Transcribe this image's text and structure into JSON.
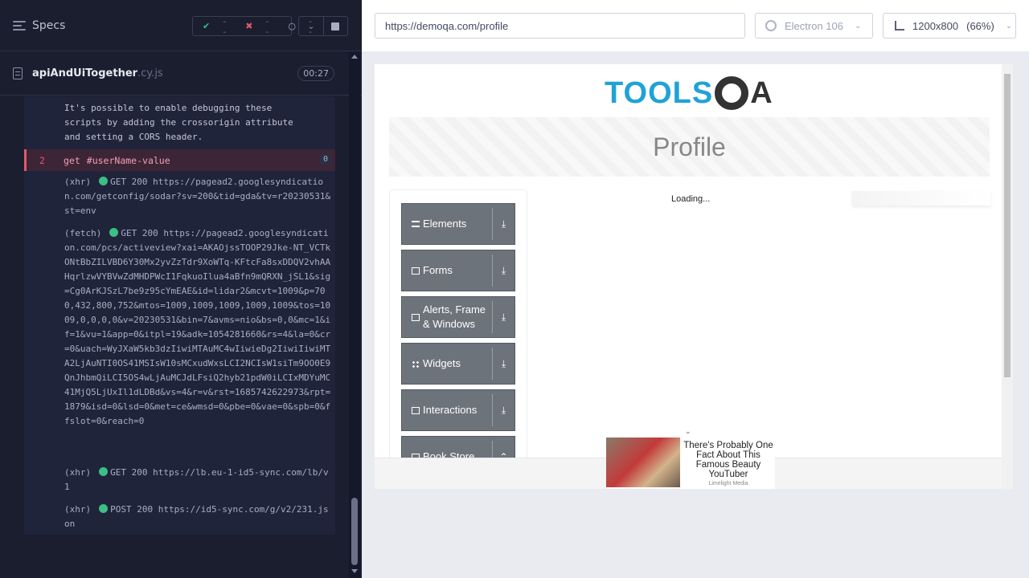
{
  "reporter": {
    "specs_label": "Specs",
    "stats": {
      "passed": "--",
      "failed": "--",
      "pending": "--"
    },
    "spec_file": {
      "name": "apiAndUiTogether",
      "ext": ".cy.js",
      "duration": "00:27"
    },
    "log_message": "It's possible to enable debugging these\nscripts by adding the crossorigin attribute\nand setting a CORS header.",
    "command": {
      "number": "2",
      "name": "get",
      "selector": "#userName-value",
      "count": "0"
    },
    "requests": [
      {
        "type": "(xhr)",
        "method": "GET 200",
        "url": "https://pagead2.googlesyndication.com/getconfig/sodar?sv=200&tid=gda&tv=r20230531&st=env"
      },
      {
        "type": "(fetch)",
        "method": "GET 200",
        "url": "https://pagead2.googlesyndication.com/pcs/activeview?xai=AKAOjssTOOP29Jke-NT_VCTkONtBbZILVBD6Y30Mx2yvZzTdr9XoWTq-KFtcFa8sxDDQV2vhAAHqrlzwVYBVwZdMHDPWcI1FqkuoIlua4aBfn9mQRXN_jSL1&sig=Cg0ArKJSzL7be9z95cYmEAE&id=lidar2&mcvt=1009&p=700,432,800,752&mtos=1009,1009,1009,1009,1009&tos=1009,0,0,0,0&v=20230531&bin=7&avms=nio&bs=0,0&mc=1&if=1&vu=1&app=0&itpl=19&adk=1054281660&rs=4&la=0&cr=0&uach=WyJXaW5kb3dzIiwiMTAuMC4wIiwieDg2IiwiIiwiMTA2LjAuNTI0OS41MSIsW10sMCxudWxsLCI2NCIsW1siTm9OO0E9QnJhbmQiLCI5OS4wLjAuMCJdLFsiQ2hyb21pdW0iLCIxMDYuMC41MjQ5LjUxIl1dLDBd&vs=4&r=v&rst=1685742622973&rpt=1879&isd=0&lsd=0&met=ce&wmsd=0&pbe=0&vae=0&spb=0&ffslot=0&reach=0"
      },
      {
        "type": "(xhr)",
        "method": "GET 200",
        "url": "https://lb.eu-1-id5-sync.com/lb/v1"
      },
      {
        "type": "(xhr)",
        "method": "POST 200",
        "url": "https://id5-sync.com/g/v2/231.json"
      }
    ]
  },
  "aut": {
    "url": "https://demoqa.com/profile",
    "browser": "Electron 106",
    "viewport": "1200x800",
    "zoom": "(66%)"
  },
  "page": {
    "logo_left": "TOOLS",
    "logo_right": "A",
    "title": "Profile",
    "loading": "Loading...",
    "groups": [
      {
        "label": "Elements",
        "icon": "list-icon"
      },
      {
        "label": "Forms",
        "icon": "form-icon"
      },
      {
        "label": "Alerts, Frame & Windows",
        "icon": "window-icon"
      },
      {
        "label": "Widgets",
        "icon": "widgets-icon"
      },
      {
        "label": "Interactions",
        "icon": "interactions-icon"
      },
      {
        "label": "Book Store",
        "icon": "book-icon"
      }
    ],
    "ad": {
      "headline": "There's Probably One Fact About This Famous Beauty YouTuber",
      "source": "Limelight Media"
    }
  },
  "colors": {
    "pass": "#3bbf85",
    "fail": "#e45770",
    "brand": "#21a2d6"
  }
}
